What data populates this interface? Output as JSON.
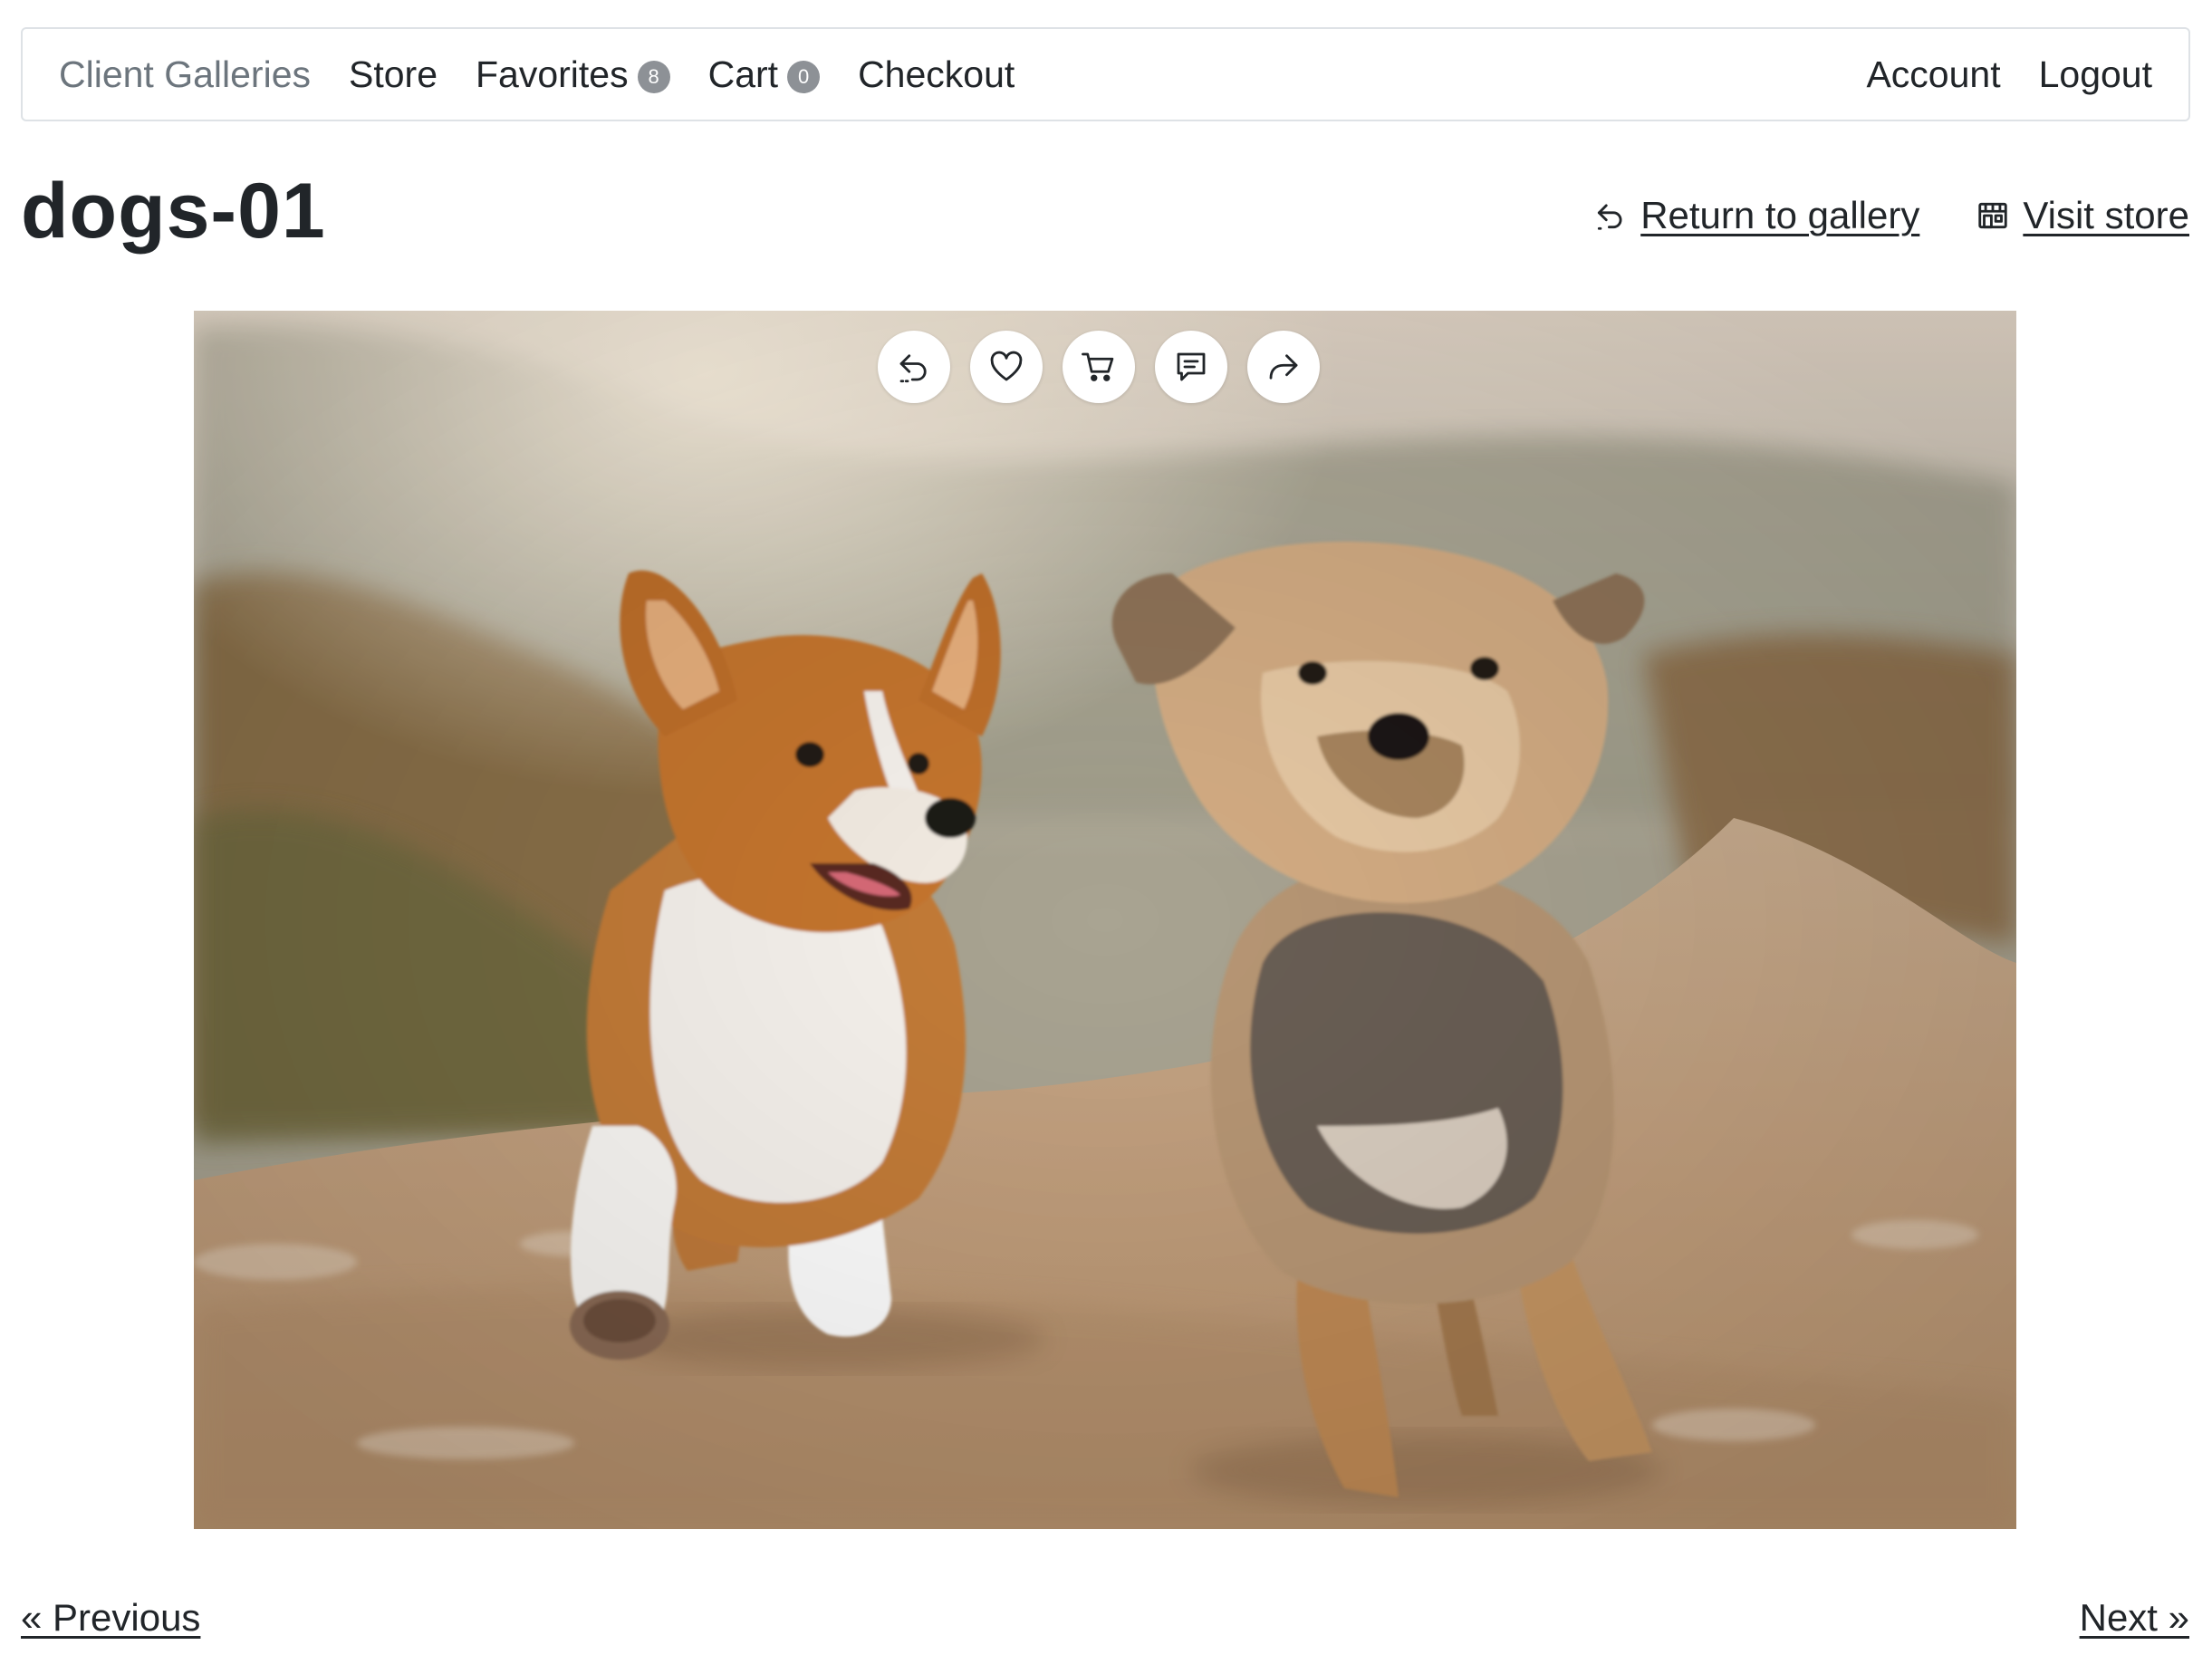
{
  "navbar": {
    "brand": "Client Galleries",
    "store": "Store",
    "favorites": "Favorites",
    "favorites_count": "8",
    "cart": "Cart",
    "cart_count": "0",
    "checkout": "Checkout",
    "account": "Account",
    "logout": "Logout"
  },
  "page": {
    "title": "dogs-01",
    "return_link": "Return to gallery",
    "store_link": "Visit store"
  },
  "photo": {
    "toolbar_icons": [
      "return-icon",
      "heart-icon",
      "cart-icon",
      "comment-icon",
      "share-icon"
    ]
  },
  "pager": {
    "previous": "« Previous",
    "next": "Next »"
  },
  "colors": {
    "text": "#212529",
    "muted": "#6c757d",
    "badge": "#8d9196",
    "border": "#dee2e6"
  }
}
